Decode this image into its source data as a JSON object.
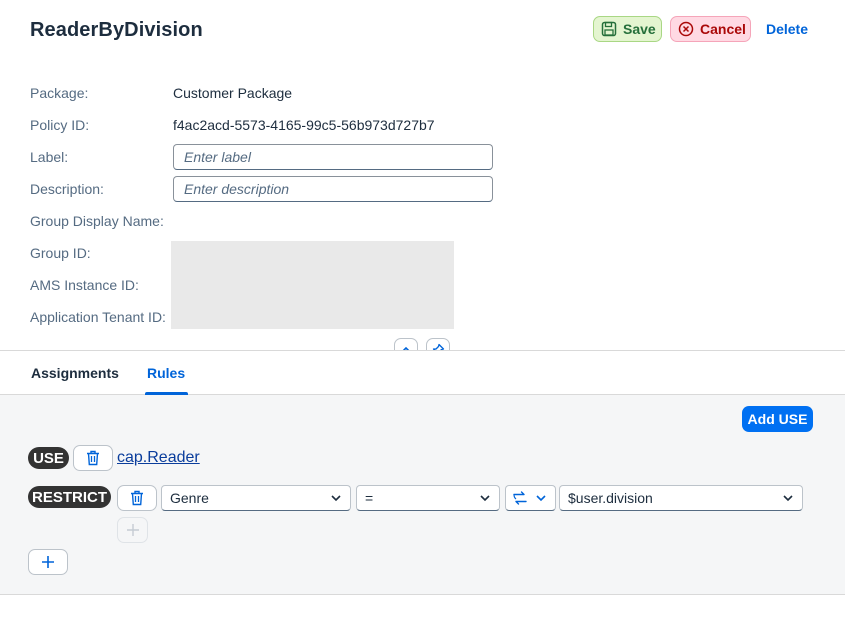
{
  "header": {
    "title": "ReaderByDivision",
    "save_label": "Save",
    "cancel_label": "Cancel",
    "delete_label": "Delete"
  },
  "form": {
    "package_label": "Package:",
    "package_value": "Customer Package",
    "policy_id_label": "Policy ID:",
    "policy_id_value": "f4ac2acd-5573-4165-99c5-56b973d727b7",
    "label_label": "Label:",
    "label_placeholder": "Enter label",
    "description_label": "Description:",
    "description_placeholder": "Enter description",
    "group_display_name_label": "Group Display Name:",
    "group_id_label": "Group ID:",
    "ams_instance_id_label": "AMS Instance ID:",
    "application_tenant_id_label": "Application Tenant ID:"
  },
  "tabs": [
    {
      "label": "Assignments",
      "selected": false
    },
    {
      "label": "Rules",
      "selected": true
    }
  ],
  "rules": {
    "add_use_label": "Add USE",
    "use_pill": "USE",
    "use_link": "cap.Reader",
    "restrict_pill": "RESTRICT",
    "attribute_select": "Genre",
    "operator_select": "=",
    "value_select": "$user.division"
  },
  "icons": {
    "save": "save-icon",
    "cancel": "cancel-circle-icon",
    "collapse": "chevron-up-icon",
    "pin": "pin-icon",
    "trash": "trash-icon",
    "swap": "swap-arrows-icon",
    "add": "plus-icon"
  },
  "colors": {
    "accent": "#0064d9",
    "save_bg": "#e4f5d0",
    "cancel_bg": "#ffd9e3",
    "pill_bg": "#333333"
  }
}
